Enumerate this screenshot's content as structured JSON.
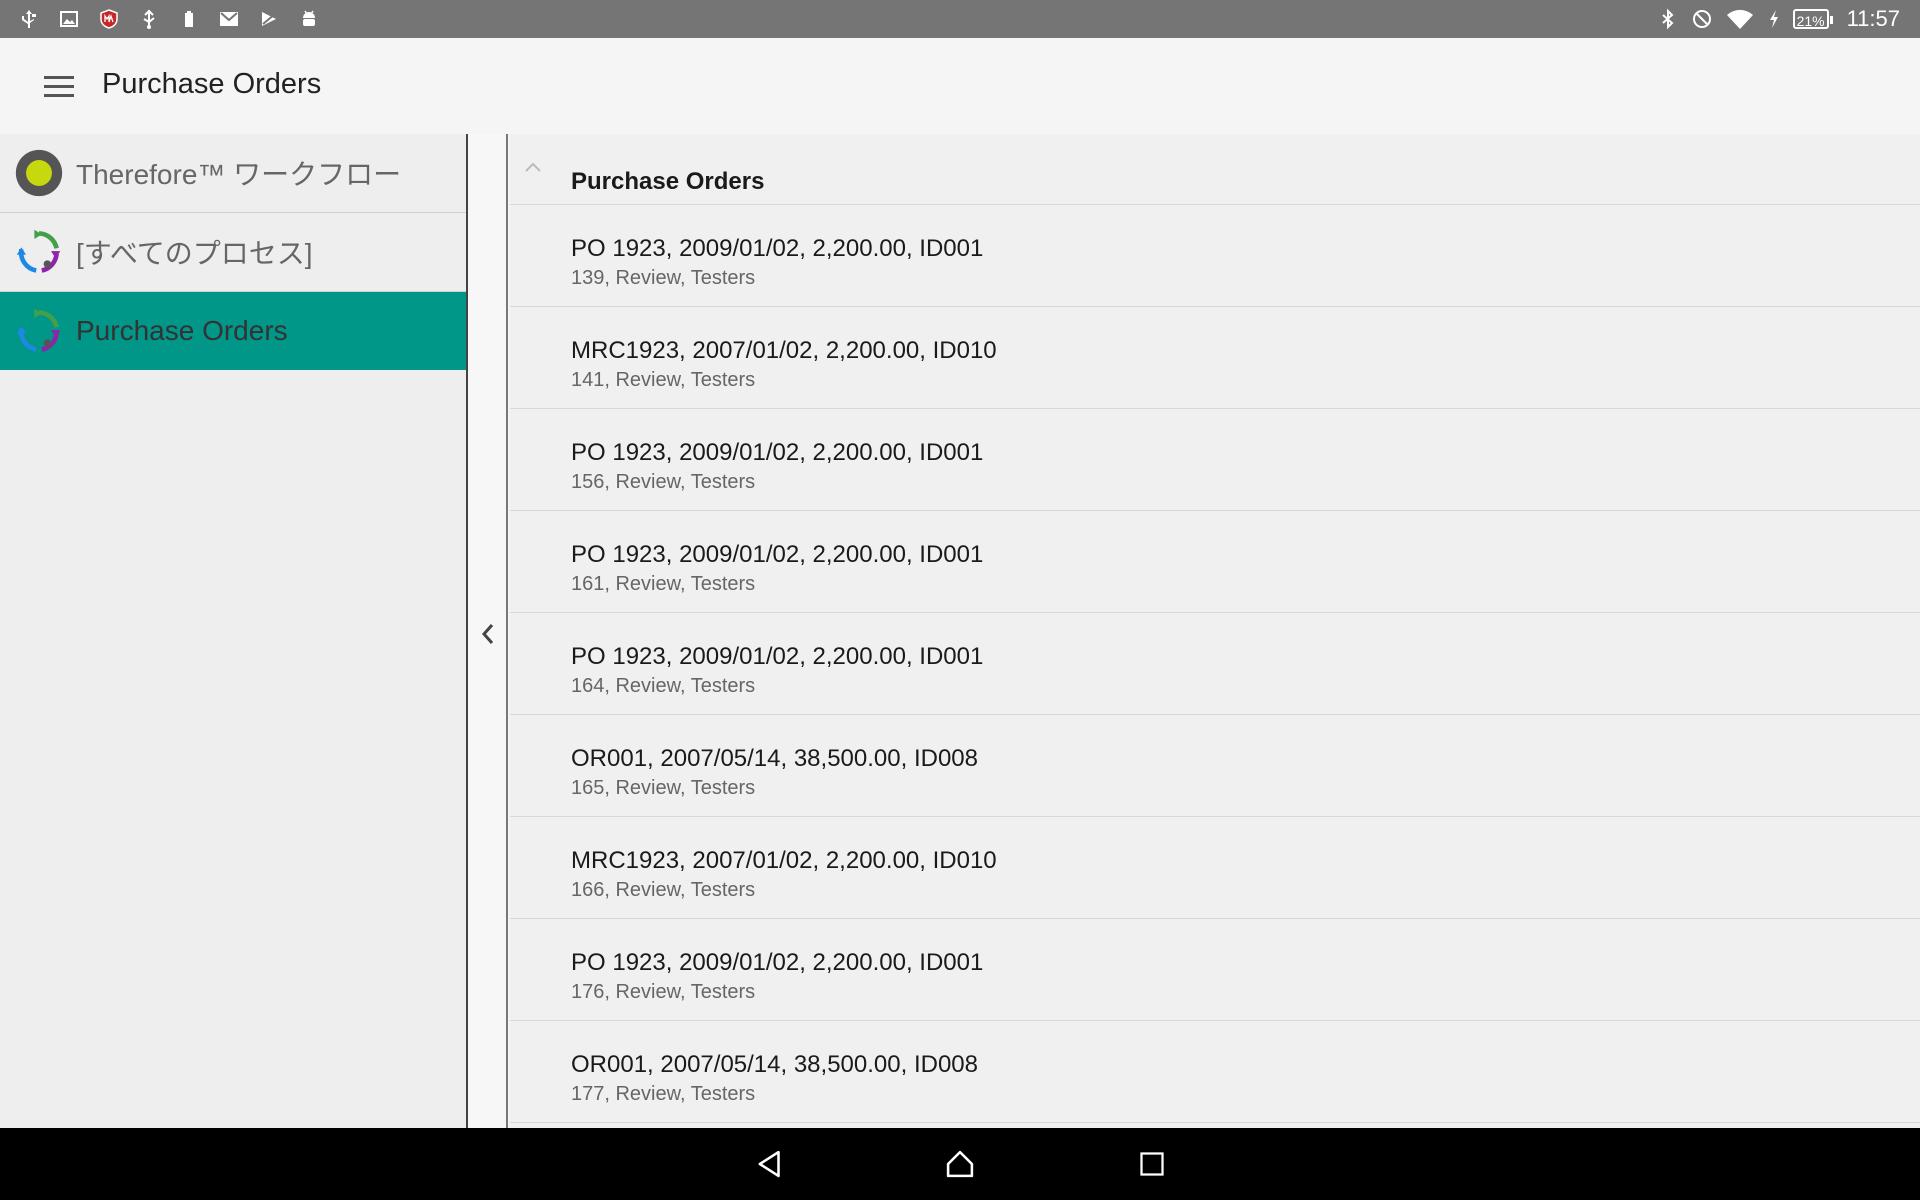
{
  "status_bar": {
    "left_icons": [
      "usb-icon",
      "image-icon",
      "mcafee-icon",
      "usb-debug-icon",
      "sd-card-icon",
      "gmail-icon",
      "play-store-icon",
      "android-icon"
    ],
    "right_icons": [
      "bluetooth-icon",
      "do-not-disturb-icon",
      "wifi-icon",
      "charging-icon"
    ],
    "battery": "21%",
    "time": "11:57"
  },
  "app_bar": {
    "title": "Purchase Orders",
    "menu_icon": "hamburger-menu-icon"
  },
  "sidebar": {
    "items": [
      {
        "label": "Therefore™ ワークフロー",
        "icon": "workflow-status-icon",
        "active": false
      },
      {
        "label": "[すべてのプロセス]",
        "icon": "process-cycle-icon",
        "active": false
      },
      {
        "label": "Purchase Orders",
        "icon": "process-cycle-icon",
        "active": true
      }
    ]
  },
  "main": {
    "group_title": "Purchase Orders",
    "rows": [
      {
        "title": "PO 1923, 2009/01/02, 2,200.00, ID001",
        "subtitle": "139, Review, Testers"
      },
      {
        "title": "MRC1923, 2007/01/02, 2,200.00, ID010",
        "subtitle": "141, Review, Testers"
      },
      {
        "title": "PO 1923, 2009/01/02, 2,200.00, ID001",
        "subtitle": "156, Review, Testers"
      },
      {
        "title": "PO 1923, 2009/01/02, 2,200.00, ID001",
        "subtitle": "161, Review, Testers"
      },
      {
        "title": "PO 1923, 2009/01/02, 2,200.00, ID001",
        "subtitle": "164, Review, Testers"
      },
      {
        "title": "OR001, 2007/05/14, 38,500.00, ID008",
        "subtitle": "165, Review, Testers"
      },
      {
        "title": "MRC1923, 2007/01/02, 2,200.00, ID010",
        "subtitle": "166, Review, Testers"
      },
      {
        "title": "PO 1923, 2009/01/02, 2,200.00, ID001",
        "subtitle": "176, Review, Testers"
      },
      {
        "title": "OR001, 2007/05/14, 38,500.00, ID008",
        "subtitle": "177, Review, Testers"
      }
    ]
  },
  "nav_bar": {
    "buttons": [
      "back-icon",
      "home-icon",
      "recents-icon"
    ]
  },
  "colors": {
    "status_bar": "#757575",
    "accent": "#009688",
    "sidebar_bg": "#eeeeee",
    "list_bg": "#f0f0f0"
  }
}
